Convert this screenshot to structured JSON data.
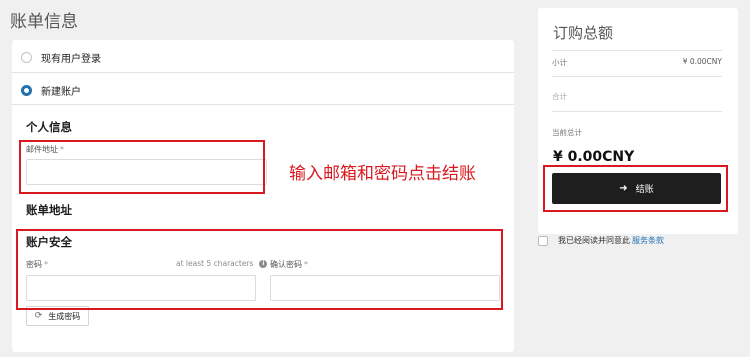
{
  "page": {
    "title": "账单信息"
  },
  "account_options": [
    {
      "label": "现有用户登录",
      "checked": false
    },
    {
      "label": "新建账户",
      "checked": true
    }
  ],
  "personal": {
    "heading": "个人信息",
    "email_label": "邮件地址",
    "email_value": ""
  },
  "billing": {
    "heading": "账单地址"
  },
  "security": {
    "heading": "账户安全",
    "password_label": "密码",
    "password_hint": "at least 5 characters",
    "password_value": "",
    "confirm_label": "确认密码",
    "confirm_value": "",
    "generate_label": "生成密码"
  },
  "annotation": "输入邮箱和密码点击结账",
  "summary": {
    "title": "订购总额",
    "subtotal_label": "小计",
    "subtotal_value": "¥ 0.00CNY",
    "total_label": "合计",
    "current_total_label": "当前总计",
    "current_total_value": "¥ 0.00CNY",
    "checkout_label": "结账"
  },
  "terms": {
    "text": "我已经阅读并同意此",
    "link": "服务条款"
  },
  "colors": {
    "accent": "#2271b1",
    "annotation": "#d9191f",
    "button": "#1e1e1e"
  },
  "icons": [
    "info-icon",
    "refresh-icon",
    "arrow-right-icon"
  ]
}
